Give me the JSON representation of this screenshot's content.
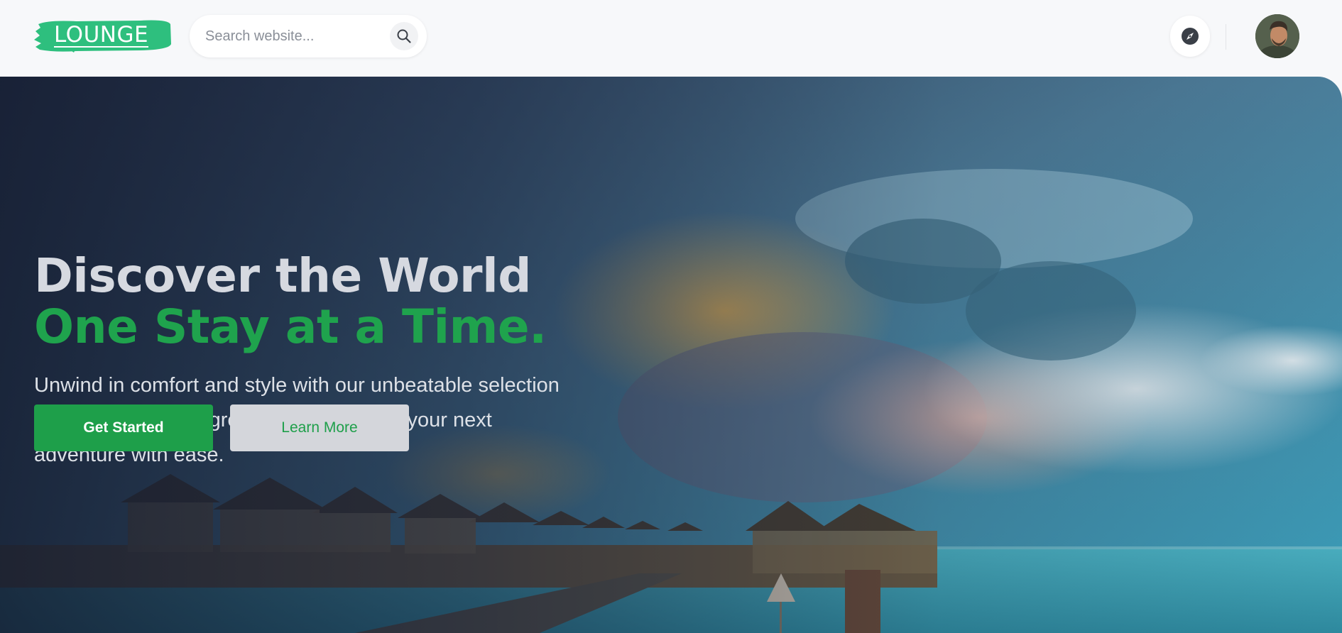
{
  "brand": {
    "logo_text": "LOUNGE",
    "accent_color": "#2ebf7e"
  },
  "search": {
    "placeholder": "Search website...",
    "icon": "search-icon"
  },
  "header_actions": {
    "explore_icon": "compass-icon",
    "avatar_icon": "user-avatar"
  },
  "hero": {
    "title_line_1": "Discover the World",
    "title_line_2": "One Stay at a Time.",
    "subtitle": "Unwind in comfort and style with our unbeatable selection of hotels. Discover great deals and book your next adventure with ease.",
    "primary_button": "Get Started",
    "secondary_button": "Learn More",
    "highlight_color": "#1fa34d",
    "background": "overwater bungalows at sunset"
  }
}
